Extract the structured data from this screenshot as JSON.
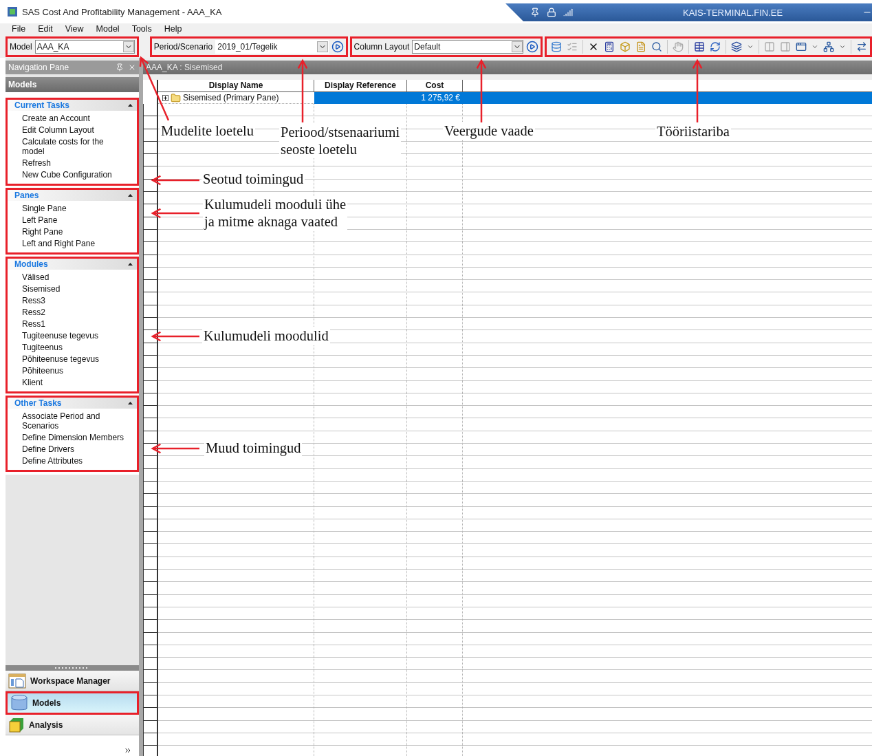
{
  "window": {
    "title": "SAS Cost And Profitability Management - AAA_KA"
  },
  "remote_bar": {
    "host": "KAIS-TERMINAL.FIN.EE"
  },
  "menu": [
    "File",
    "Edit",
    "View",
    "Model",
    "Tools",
    "Help"
  ],
  "toolbar": {
    "model": {
      "label": "Model",
      "value": "AAA_KA"
    },
    "period": {
      "label": "Period/Scenario",
      "value": "2019_01/Tegelik"
    },
    "column_layout": {
      "label": "Column Layout",
      "value": "Default"
    }
  },
  "navigation_pane": {
    "title": "Navigation Pane",
    "header": "Models",
    "sections": [
      {
        "title": "Current Tasks",
        "items": [
          "Create an Account",
          "Edit Column Layout",
          "Calculate costs for the model",
          "Refresh",
          "New Cube Configuration"
        ]
      },
      {
        "title": "Panes",
        "items": [
          "Single Pane",
          "Left Pane",
          "Right Pane",
          "Left and Right Pane"
        ]
      },
      {
        "title": "Modules",
        "items": [
          "Välised",
          "Sisemised",
          "Ress3",
          "Ress2",
          "Ress1",
          "Tugiteenuse tegevus",
          "Tugiteenus",
          "Põhiteenuse tegevus",
          "Põhiteenus",
          "Klient"
        ]
      },
      {
        "title": "Other Tasks",
        "items": [
          "Associate Period and Scenarios",
          "Define Dimension Members",
          "Define Drivers",
          "Define Attributes"
        ]
      }
    ],
    "buttons": [
      {
        "label": "Workspace Manager",
        "kind": "workspace",
        "selected": false
      },
      {
        "label": "Models",
        "kind": "models",
        "selected": true
      },
      {
        "label": "Analysis",
        "kind": "analysis",
        "selected": false
      }
    ]
  },
  "content": {
    "title": "AAA_KA : Sisemised",
    "columns": [
      "Display Name",
      "Display Reference",
      "Cost"
    ],
    "rows": [
      {
        "display_name": "Sisemised (Primary Pane)",
        "cost": "1 275,92 €",
        "selected": true,
        "expanded": false
      }
    ]
  },
  "annotations": [
    {
      "text": "Mudelite loetelu"
    },
    {
      "text": "Periood/stsenaariumi\nseoste loetelu"
    },
    {
      "text": "Veergude vaade"
    },
    {
      "text": "Tööriistariba"
    },
    {
      "text": "Seotud toimingud"
    },
    {
      "text": "Kulumudeli mooduli ühe\nja mitme aknaga vaated"
    },
    {
      "text": "Kulumudeli moodulid"
    },
    {
      "text": "Muud toimingud"
    }
  ]
}
